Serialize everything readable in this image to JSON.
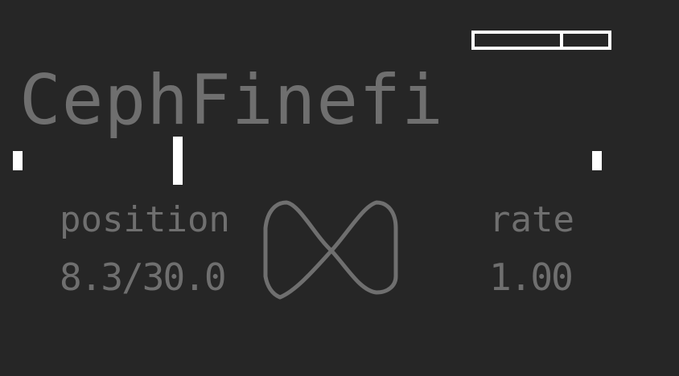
{
  "title": "CephFinefi",
  "battery": {
    "level": 0.66
  },
  "playback": {
    "progress": 0.277
  },
  "position": {
    "label": "position",
    "value": "8.3/30.0"
  },
  "rate": {
    "label": "rate",
    "value": "1.00"
  },
  "icons": {
    "mode": "loop-icon"
  },
  "colors": {
    "background": "#262626",
    "text": "#6f6f6f",
    "highlight": "#ffffff"
  }
}
